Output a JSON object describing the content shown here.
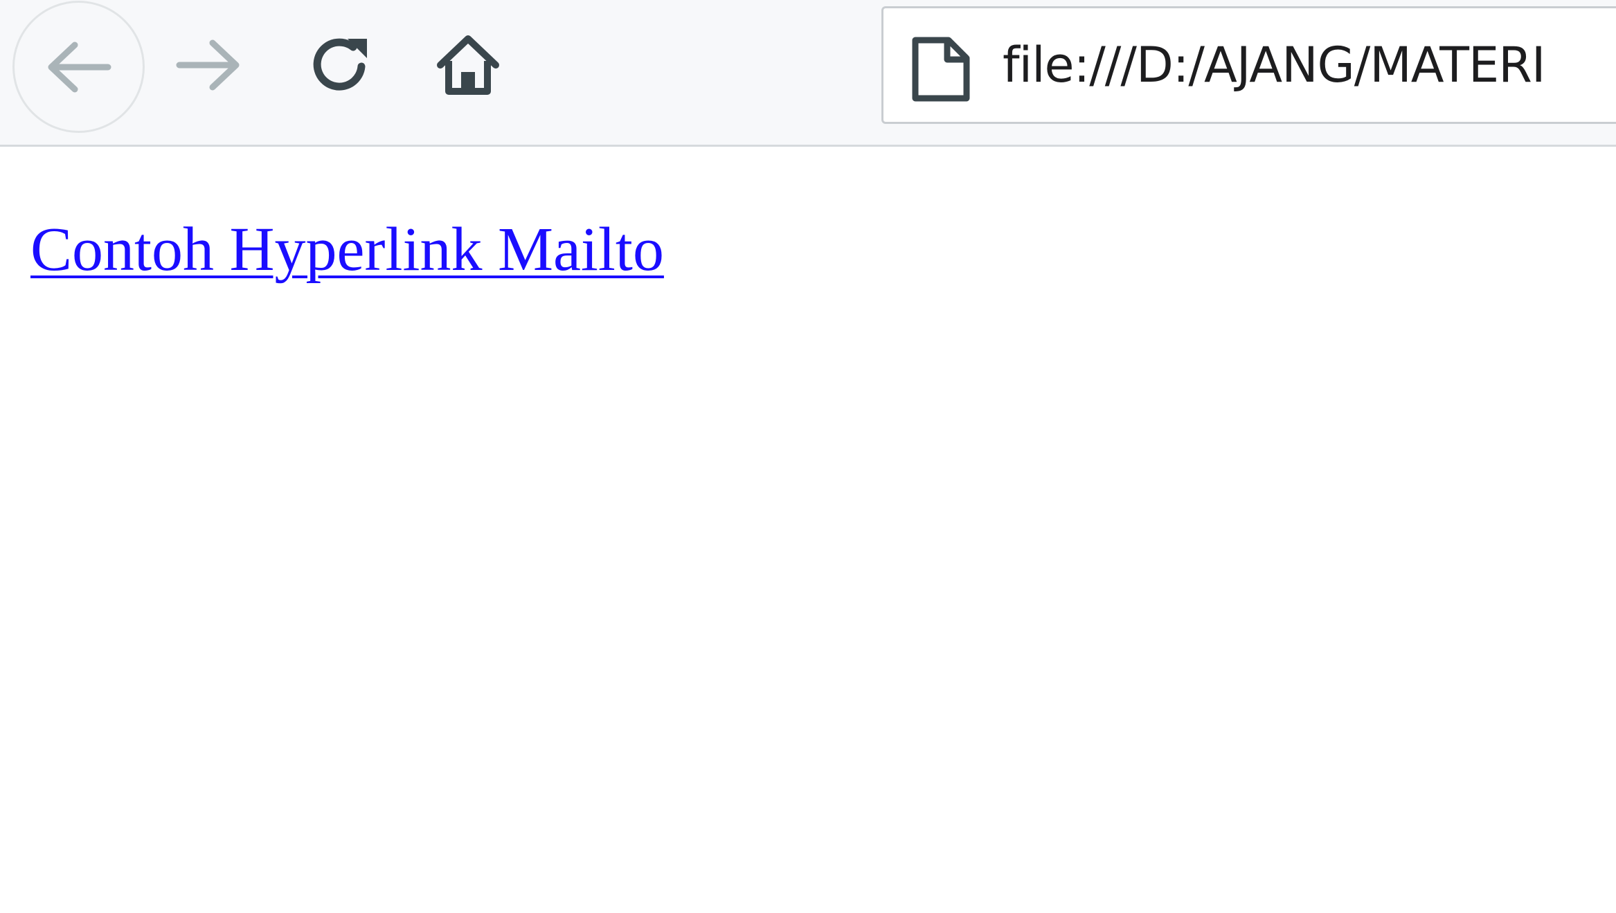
{
  "browser": {
    "toolbar": {
      "back_icon": "arrow-left-icon",
      "forward_icon": "arrow-right-icon",
      "reload_icon": "reload-icon",
      "home_icon": "home-icon"
    },
    "address_bar": {
      "page_icon": "document-icon",
      "url": "file:///D:/AJANG/MATERI"
    }
  },
  "page": {
    "link_text": "Contoh Hyperlink Mailto"
  },
  "colors": {
    "toolbar_bg": "#f7f8fa",
    "icon_dark": "#3a464c",
    "icon_disabled": "#aab4b8",
    "link": "#1a0dff"
  }
}
